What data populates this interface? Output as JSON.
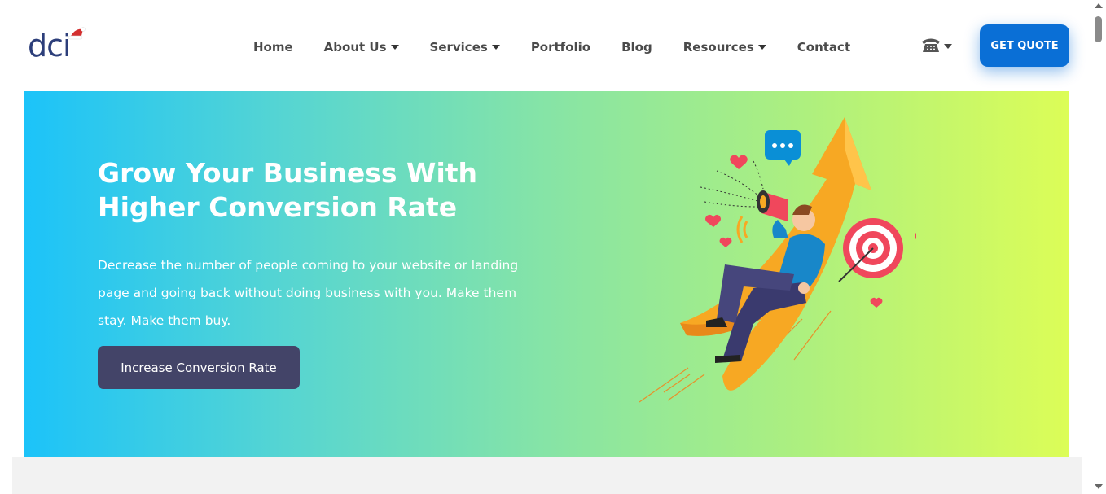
{
  "logo": {
    "text": "dci"
  },
  "nav": {
    "items": [
      {
        "label": "Home"
      },
      {
        "label": "About Us"
      },
      {
        "label": "Services"
      },
      {
        "label": "Portfolio"
      },
      {
        "label": "Blog"
      },
      {
        "label": "Resources"
      },
      {
        "label": "Contact"
      }
    ]
  },
  "header": {
    "quote_label": "GET QUOTE",
    "phone_icon": "phone-icon"
  },
  "hero": {
    "title_line1": "Grow Your Business With",
    "title_line2": "Higher Conversion Rate",
    "description": "Decrease the number of people coming to your website or landing page and going back without doing business with you. Make them stay. Make them buy.",
    "cta_label": "Increase Conversion Rate"
  },
  "colors": {
    "brand_blue": "#0a6fd6",
    "cta_dark": "#434468",
    "gradient_start": "#1cc3f9",
    "gradient_end": "#dcfd57",
    "logo_color": "#2c3e7a"
  }
}
